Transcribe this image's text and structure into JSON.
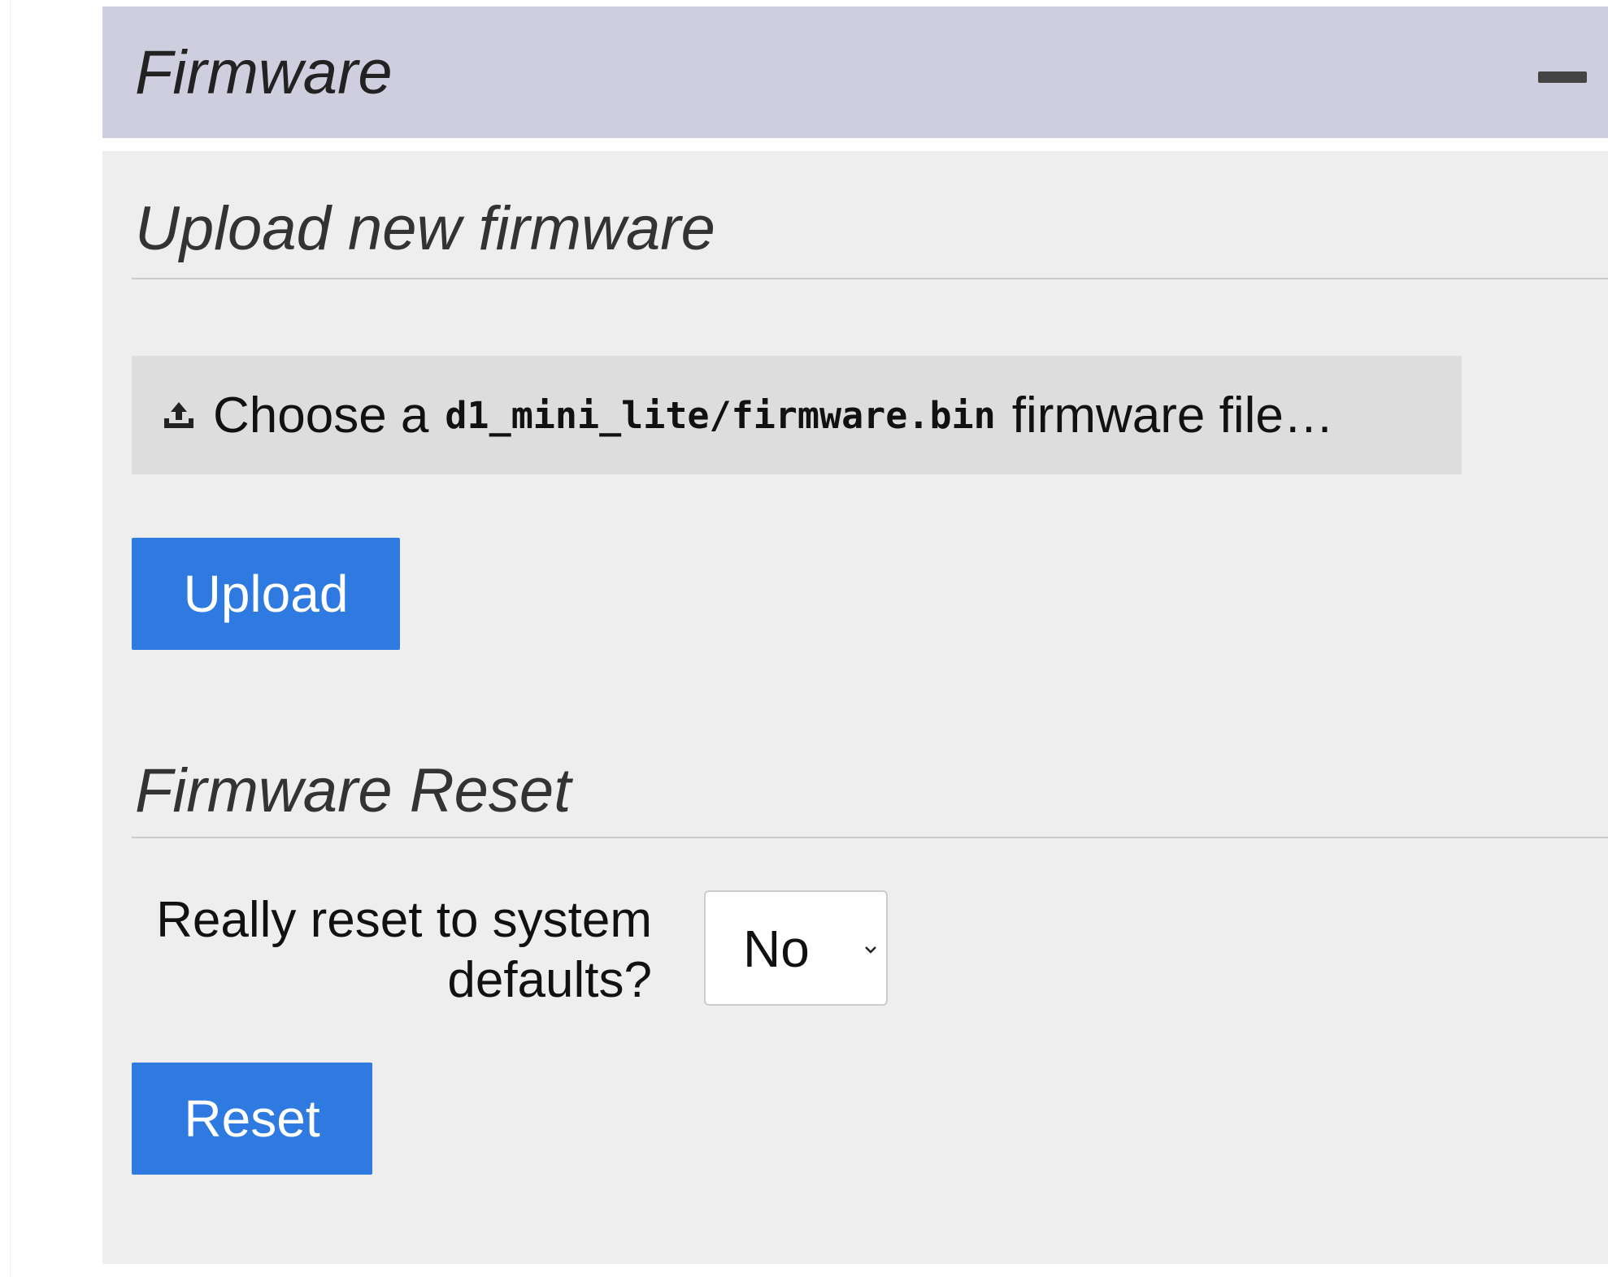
{
  "panel": {
    "title": "Firmware",
    "collapse_icon": "minus-icon"
  },
  "upload_section": {
    "heading": "Upload new firmware",
    "file_chooser": {
      "icon": "upload-icon",
      "prefix": "Choose a",
      "filename": "d1_mini_lite/firmware.bin",
      "suffix": "firmware file…"
    },
    "upload_button": "Upload"
  },
  "reset_section": {
    "heading": "Firmware Reset",
    "label": "Really reset to system defaults?",
    "select": {
      "value": "No",
      "icon": "chevron-down-icon"
    },
    "reset_button": "Reset"
  },
  "colors": {
    "header_bg": "#cfcedf",
    "body_bg": "#eeeeee",
    "button_bg": "#2f7ae0",
    "chooser_bg": "#dddddd"
  }
}
